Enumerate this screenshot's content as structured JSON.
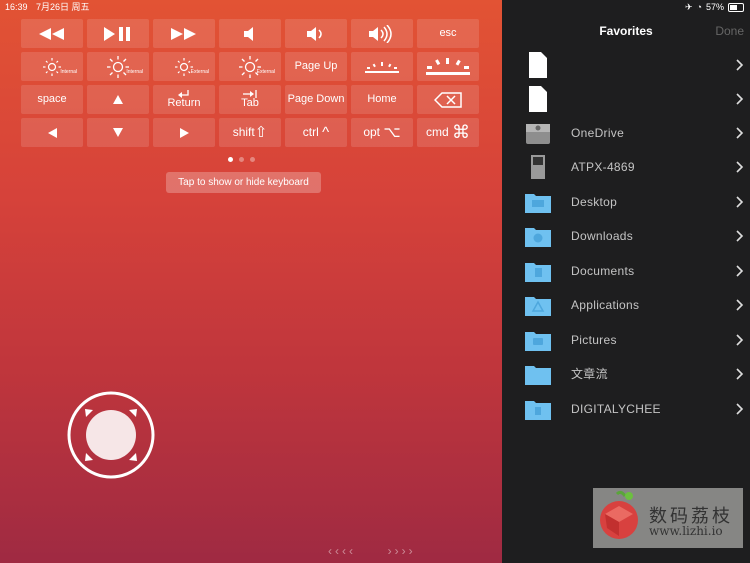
{
  "status_bar": {
    "time": "16:39",
    "date": "7月26日 周五",
    "battery": "57%"
  },
  "keyboard": {
    "rows": [
      [
        {
          "name": "rewind",
          "icon": "rewind-icon"
        },
        {
          "name": "play-pause",
          "icon": "play-pause-icon"
        },
        {
          "name": "fast-forward",
          "icon": "fast-forward-icon"
        },
        {
          "name": "volume-mute",
          "icon": "speaker-mute-icon"
        },
        {
          "name": "volume-down",
          "icon": "speaker-low-icon"
        },
        {
          "name": "volume-up",
          "icon": "speaker-high-icon"
        },
        {
          "name": "escape",
          "label": "esc"
        }
      ],
      [
        {
          "name": "brightness-down-internal",
          "icon": "sun-small-icon",
          "sub": "Internal"
        },
        {
          "name": "brightness-up-internal",
          "icon": "sun-large-icon",
          "sub": "Internal"
        },
        {
          "name": "brightness-down-external",
          "icon": "sun-small-icon",
          "sub": "External"
        },
        {
          "name": "brightness-up-external",
          "icon": "sun-large-icon",
          "sub": "External"
        },
        {
          "name": "page-up",
          "label": "Page Up"
        },
        {
          "name": "keyboard-backlight-down",
          "icon": "backlight-low-icon"
        },
        {
          "name": "keyboard-backlight-up",
          "icon": "backlight-high-icon"
        }
      ],
      [
        {
          "name": "space",
          "label": "space"
        },
        {
          "name": "arrow-up",
          "icon": "triangle-up-icon"
        },
        {
          "name": "return",
          "label": "Return",
          "icon": "return-icon"
        },
        {
          "name": "tab",
          "label": "Tab",
          "icon": "tab-icon"
        },
        {
          "name": "page-down",
          "label": "Page Down"
        },
        {
          "name": "home",
          "label": "Home"
        },
        {
          "name": "delete",
          "icon": "delete-icon"
        }
      ],
      [
        {
          "name": "arrow-left",
          "icon": "triangle-left-icon"
        },
        {
          "name": "arrow-down",
          "icon": "triangle-down-icon"
        },
        {
          "name": "arrow-right",
          "icon": "triangle-right-icon"
        },
        {
          "name": "shift",
          "label": "shift",
          "glyph": "⇧"
        },
        {
          "name": "control",
          "label": "ctrl",
          "glyph": "^"
        },
        {
          "name": "option",
          "label": "opt",
          "glyph": "⌥"
        },
        {
          "name": "command",
          "label": "cmd",
          "glyph": "⌘"
        }
      ]
    ]
  },
  "page_indicator": {
    "count": 3,
    "current": 1
  },
  "hint": "Tap to show or hide keyboard",
  "pager": {
    "left": "‹‹‹‹",
    "right": "››››"
  },
  "favorites": {
    "title": "Favorites",
    "done_label": "Done",
    "items": [
      {
        "label": "",
        "icon": "document-icon"
      },
      {
        "label": "",
        "icon": "document-icon"
      },
      {
        "label": "OneDrive",
        "icon": "drive-icon"
      },
      {
        "label": "ATPX-4869",
        "icon": "sd-card-icon"
      },
      {
        "label": "Desktop",
        "icon": "folder-desktop-icon"
      },
      {
        "label": "Downloads",
        "icon": "folder-downloads-icon"
      },
      {
        "label": "Documents",
        "icon": "folder-documents-icon"
      },
      {
        "label": "Applications",
        "icon": "folder-applications-icon"
      },
      {
        "label": "Pictures",
        "icon": "folder-pictures-icon"
      },
      {
        "label": "文章流",
        "icon": "folder-icon"
      },
      {
        "label": "DIGITALYCHEE",
        "icon": "folder-icon"
      }
    ]
  },
  "watermark": {
    "text_cn": "数码荔枝",
    "url": "www.lizhi.io"
  },
  "colors": {
    "accent_gradient_top": "#e25334",
    "accent_gradient_bottom": "#9f2a42",
    "panel": "#1e1e1f",
    "folder": "#6fc1f0"
  }
}
